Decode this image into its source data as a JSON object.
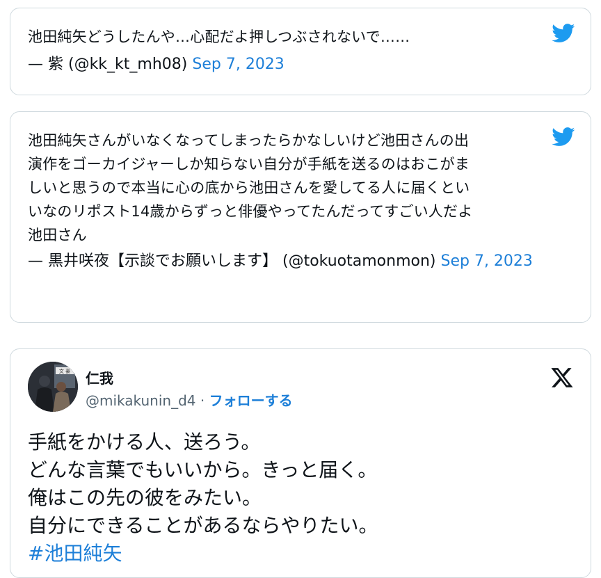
{
  "tweets": [
    {
      "text": "池田純矢どうしたんや…心配だよ押しつぶされないで……",
      "attribution": "— 紫 (@kk_kt_mh08)",
      "date": "Sep 7, 2023"
    },
    {
      "text": "池田純矢さんがいなくなってしまったらかなしいけど池田さんの出\n演作をゴーカイジャーしか知らない自分が手紙を送るのはおこがま\nしいと思うので本当に心の底から池田さんを愛してる人に届くとい\nいなのリポスト14歳からずっと俳優やってたんだってすごい人だよ\n池田さん",
      "attribution": "— 黒井咲夜【示談でお願いします】 (@tokuotamonmon)",
      "date": "Sep 7, 2023"
    }
  ],
  "embed": {
    "author_name": "仁我",
    "handle": "@mikakunin_d4",
    "separator": " · ",
    "follow_label": "フォローする",
    "lines": [
      "手紙をかける人、送ろう。",
      "どんな言葉でもいいから。きっと届く。",
      "俺はこの先の彼をみたい。",
      "自分にできることがあるならやりたい。"
    ],
    "hashtag": "#池田純矢",
    "avatar_text": "文 豪"
  },
  "icons": {
    "tweet_logo": "twitter-bird-icon",
    "embed_logo": "x-logo-icon"
  },
  "colors": {
    "link": "#1d7fd8",
    "bird": "#1d9bf0",
    "border": "#cfd9de",
    "muted": "#536471"
  }
}
